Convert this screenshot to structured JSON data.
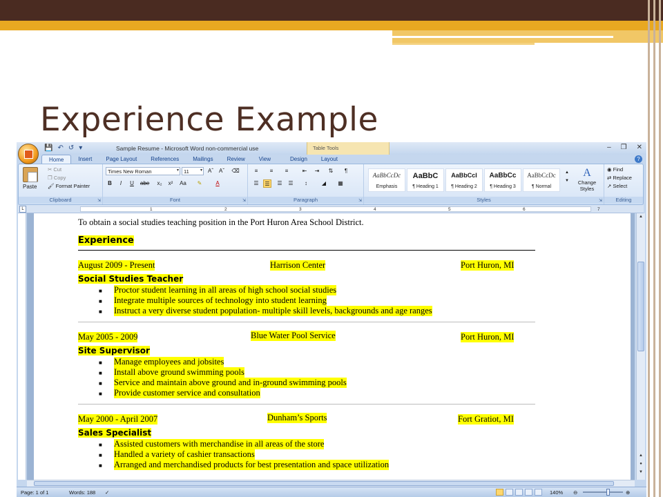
{
  "slide": {
    "title": "Experience Example"
  },
  "word": {
    "window_title": "Sample Resume - Microsoft Word non-commercial use",
    "context_tab": "Table Tools",
    "tabs": [
      "Home",
      "Insert",
      "Page Layout",
      "References",
      "Mailings",
      "Review",
      "View",
      "Design",
      "Layout"
    ],
    "clipboard": {
      "paste": "Paste",
      "cut": "Cut",
      "copy": "Copy",
      "format_painter": "Format Painter",
      "label": "Clipboard"
    },
    "font": {
      "name": "Times New Roman",
      "size": "11",
      "label": "Font"
    },
    "paragraph": {
      "label": "Paragraph"
    },
    "styles": {
      "items": [
        {
          "sample": "AaBbCcDc",
          "name": "Emphasis"
        },
        {
          "sample": "AaBbC",
          "name": "¶ Heading 1"
        },
        {
          "sample": "AaBbCcI",
          "name": "¶ Heading 2"
        },
        {
          "sample": "AaBbCc",
          "name": "¶ Heading 3"
        },
        {
          "sample": "AaBbCcDc",
          "name": "¶ Normal"
        }
      ],
      "change": "Change Styles",
      "label": "Styles"
    },
    "editing": {
      "find": "Find",
      "replace": "Replace",
      "select": "Select",
      "label": "Editing"
    },
    "ruler_numbers": [
      "1",
      "2",
      "3",
      "4",
      "5",
      "6",
      "7"
    ],
    "status": {
      "page": "Page: 1 of 1",
      "words": "Words: 188",
      "zoom": "140%"
    }
  },
  "resume": {
    "objective": "To obtain a social studies teaching position in the Port Huron Area School District.",
    "section_heading": "Experience",
    "jobs": [
      {
        "dates": "August 2009 - Present",
        "employer": "Harrison Center",
        "location": "Port Huron, MI",
        "title": "Social Studies Teacher",
        "bullets": [
          "Proctor student learning in all areas of high school social studies",
          "Integrate multiple sources of technology into student learning",
          "Instruct a very diverse student population- multiple skill levels, backgrounds and age ranges"
        ]
      },
      {
        "dates": "May 2005 - 2009",
        "employer": "Blue Water Pool Service",
        "location": "Port Huron, MI",
        "title": "Site Supervisor",
        "bullets": [
          "Manage employees and jobsites",
          "Install above ground swimming pools",
          "Service and maintain above ground and in-ground swimming pools",
          "Provide customer service and consultation"
        ]
      },
      {
        "dates": "May 2000 - April 2007",
        "employer": "Dunham’s Sports",
        "location": "Fort Gratiot, MI",
        "title": "Sales Specialist",
        "bullets": [
          "Assisted customers with merchandise in all areas of the store",
          "Handled a variety of cashier transactions",
          "Arranged and merchandised products for best presentation and space utilization"
        ]
      }
    ]
  }
}
